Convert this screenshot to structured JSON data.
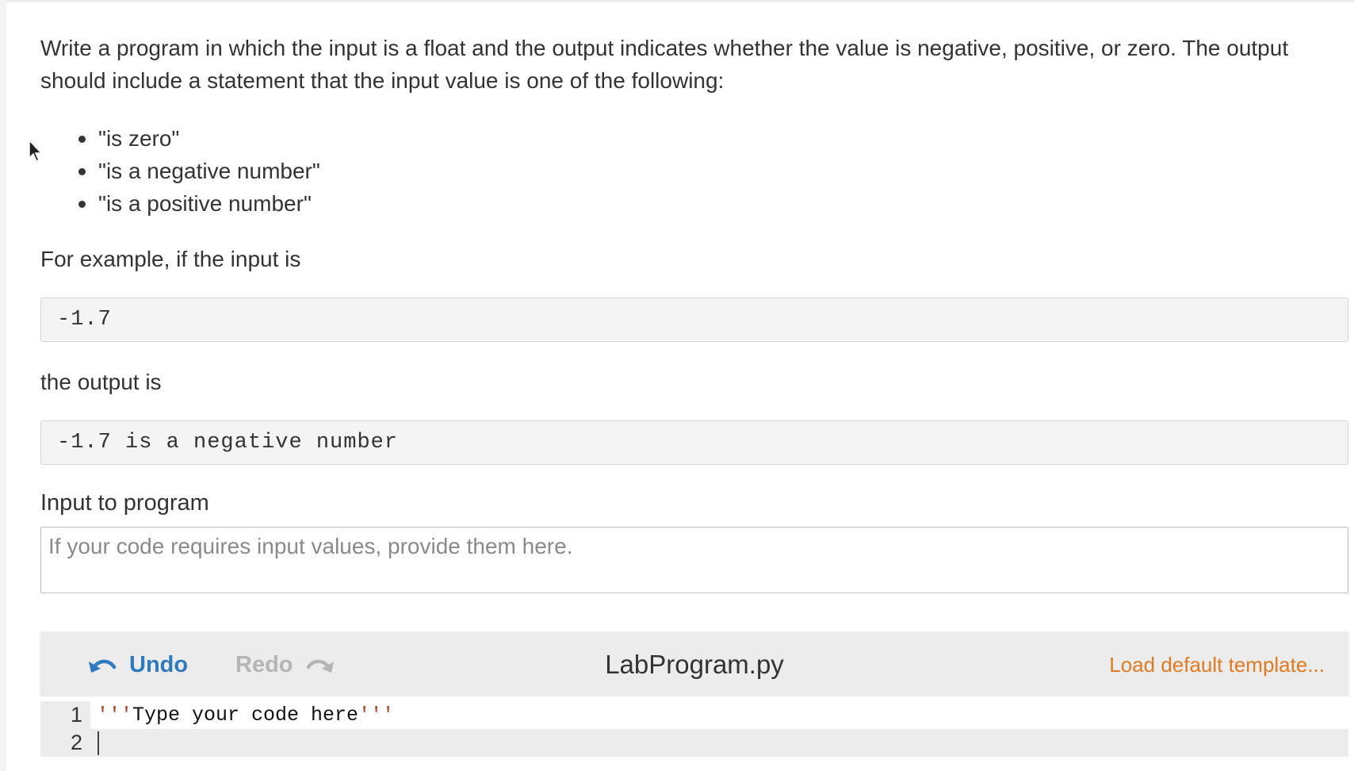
{
  "problem": {
    "intro": "Write a program in which the input is a float and the output indicates whether the value is negative, positive, or zero. The output should include a statement that the input value is one of the following:",
    "options": [
      "\"is zero\"",
      "\"is a negative number\"",
      "\"is a positive number\""
    ],
    "example_label": "For example, if the input is",
    "example_input": "-1.7",
    "output_label": "the output is",
    "example_output": "-1.7 is a negative number"
  },
  "program_input": {
    "title": "Input to program",
    "placeholder": "If your code requires input values, provide them here.",
    "value": ""
  },
  "editor": {
    "undo_label": "Undo",
    "redo_label": "Redo",
    "file_name": "LabProgram.py",
    "load_default_label": "Load default template...",
    "lines": [
      {
        "number": "1",
        "quote_open": "'''",
        "text": "Type your code here",
        "quote_close": "'''"
      },
      {
        "number": "2"
      }
    ]
  },
  "colors": {
    "undo": "#2f7bc2",
    "redo_disabled": "#b5b5b5",
    "load_default": "#e27a1f",
    "string_quote": "#b5431f"
  },
  "icons": {
    "undo": "undo-arrow-icon",
    "redo": "redo-arrow-icon",
    "cursor": "mouse-pointer-icon"
  }
}
